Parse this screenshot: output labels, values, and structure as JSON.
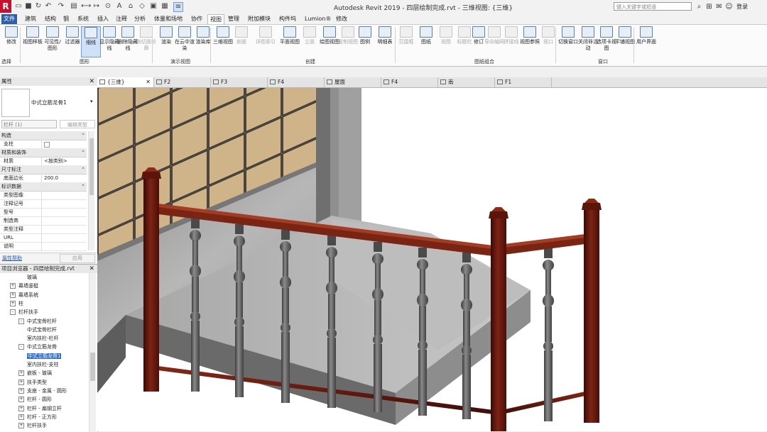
{
  "app": {
    "window_title": "Autodesk Revit 2019 - 四层绘制完成.rvt - 三维视图: {三维}",
    "search_placeholder": "键入关键字或短语",
    "login_label": "登录",
    "logo_letter": "R"
  },
  "menu_tabs": [
    "文件",
    "建筑",
    "结构",
    "钢",
    "系统",
    "插入",
    "注释",
    "分析",
    "体量和场地",
    "协作",
    "视图",
    "管理",
    "附加模块",
    "构件坞",
    "Lumion®",
    "修改"
  ],
  "active_tab": "视图",
  "ribbon": {
    "buttons": [
      {
        "label": "修改",
        "group": "选择"
      },
      {
        "label": "视图样板"
      },
      {
        "label": "可见性/图形"
      },
      {
        "label": "过滤器"
      },
      {
        "label": "细线",
        "selected": true
      },
      {
        "label": "显示隐藏线"
      },
      {
        "label": "删除隐藏线"
      },
      {
        "label": "剖切面轮廓",
        "disabled": true
      },
      {
        "label": "渲染"
      },
      {
        "label": "在云中渲染"
      },
      {
        "label": "渲染库"
      },
      {
        "label": "三维视图"
      },
      {
        "label": "剖面",
        "disabled": true
      },
      {
        "label": "详图索引",
        "disabled": true
      },
      {
        "label": "平面视图"
      },
      {
        "label": "立面",
        "disabled": true
      },
      {
        "label": "绘图视图"
      },
      {
        "label": "复制视图",
        "disabled": true
      },
      {
        "label": "图例"
      },
      {
        "label": "明细表"
      },
      {
        "label": "范围框",
        "disabled": true
      },
      {
        "label": "图纸"
      },
      {
        "label": "视图",
        "disabled": true
      },
      {
        "label": "标题栏",
        "disabled": true
      },
      {
        "label": "修订"
      },
      {
        "label": "导向轴网",
        "disabled": true
      },
      {
        "label": "拼接线",
        "disabled": true
      },
      {
        "label": "视图参照"
      },
      {
        "label": "视口",
        "disabled": true
      },
      {
        "label": "切换窗口"
      },
      {
        "label": "关闭非活动"
      },
      {
        "label": "选项卡视图"
      },
      {
        "label": "平铺视图"
      },
      {
        "label": "用户界面"
      }
    ],
    "groups": [
      "选择",
      "图形",
      "演示视图",
      "创建",
      "图纸组合",
      "窗口"
    ]
  },
  "view_tabs": [
    {
      "label": "{三维}",
      "active": true
    },
    {
      "label": "F2"
    },
    {
      "label": "F3"
    },
    {
      "label": "F4"
    },
    {
      "label": "屋面"
    },
    {
      "label": "F4"
    },
    {
      "label": "南"
    },
    {
      "label": "F1"
    }
  ],
  "properties": {
    "title": "属性",
    "type_name": "中式立筋龙骨1",
    "selector": "栏杆 (1)",
    "edit_type": "编辑类型",
    "categories": {
      "construction": "构造",
      "materials": "材质和装饰",
      "dimensions": "尺寸标注",
      "identity": "标识数据"
    },
    "rows": {
      "support": "支柱",
      "material_key": "材质",
      "material_val": "<按类别>",
      "base_offset_key": "底面边长",
      "base_offset_val": "200.0",
      "type_image": "类型图像",
      "keynote": "注释记号",
      "model": "型号",
      "manufacturer": "制造商",
      "type_comments": "类型注释",
      "url": "URL",
      "description": "说明"
    },
    "help_link": "属性帮助",
    "apply_button": "应用"
  },
  "browser": {
    "title": "项目浏览器 - 四层绘制完成.rvt",
    "items": [
      {
        "label": "玻璃",
        "indent": 3,
        "toggle": ""
      },
      {
        "label": "幕墙竖梃",
        "indent": 1,
        "toggle": "+"
      },
      {
        "label": "幕墙系统",
        "indent": 1,
        "toggle": "+"
      },
      {
        "label": "柱",
        "indent": 1,
        "toggle": "+"
      },
      {
        "label": "栏杆扶手",
        "indent": 1,
        "toggle": "-"
      },
      {
        "label": "中式宝骨栏杆",
        "indent": 2,
        "toggle": "-"
      },
      {
        "label": "中式宝骨栏杆",
        "indent": 3,
        "toggle": ""
      },
      {
        "label": "室内扶栏-栏杆",
        "indent": 3,
        "toggle": ""
      },
      {
        "label": "中式立筋龙骨",
        "indent": 2,
        "toggle": "-"
      },
      {
        "label": "中式立筋龙骨1",
        "indent": 3,
        "toggle": "",
        "selected": true
      },
      {
        "label": "室内扶栏-支柱",
        "indent": 3,
        "toggle": ""
      },
      {
        "label": "嵌板 - 玻璃",
        "indent": 2,
        "toggle": "+"
      },
      {
        "label": "扶手类型",
        "indent": 2,
        "toggle": "+"
      },
      {
        "label": "支座 - 金属 - 圆形",
        "indent": 2,
        "toggle": "+"
      },
      {
        "label": "栏杆 - 圆形",
        "indent": 2,
        "toggle": "+"
      },
      {
        "label": "栏杆 - 扁钢立杆",
        "indent": 2,
        "toggle": "+"
      },
      {
        "label": "栏杆 - 正方形",
        "indent": 2,
        "toggle": "+"
      },
      {
        "label": "栏杆扶手",
        "indent": 2,
        "toggle": "+"
      }
    ]
  },
  "colors": {
    "accent": "#2d5ea8",
    "wood": "#6b1a10",
    "tile": "#c9ae82",
    "concrete": "#9a9a9a"
  }
}
